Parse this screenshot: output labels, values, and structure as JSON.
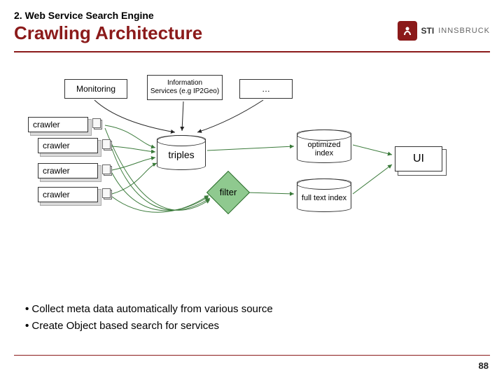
{
  "header": {
    "subtitle": "2. Web Service Search Engine",
    "title": "Crawling Architecture"
  },
  "logo": {
    "brand": "STI",
    "sub": "INNSBRUCK"
  },
  "diagram": {
    "monitoring": "Monitoring",
    "info_services": "Information\nServices (e.g IP2Geo)",
    "ellipsis": "…",
    "crawler": "crawler",
    "triples": "triples",
    "filter": "filter",
    "optimized_index": "optimized\nindex",
    "fulltext_index": "full text\nindex",
    "ui": "UI"
  },
  "bullets": {
    "b1": "Collect meta data automatically from various source",
    "b2": "Create Object based search for services"
  },
  "page_number": "88"
}
